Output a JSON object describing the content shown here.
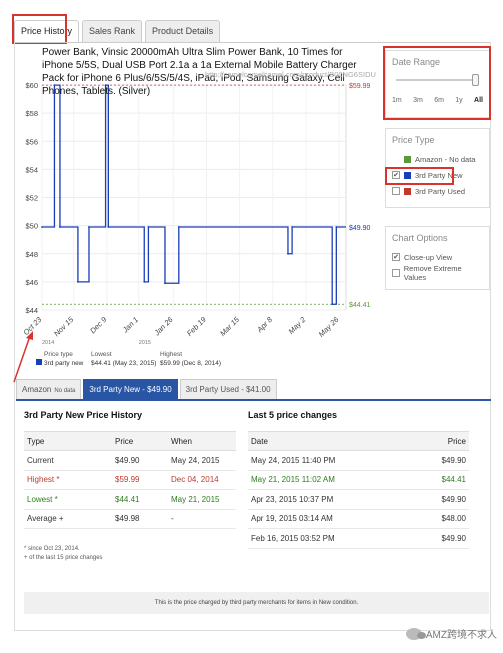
{
  "top_tabs": [
    "Price History",
    "Sales Rank",
    "Product Details"
  ],
  "product_title": "Power Bank, Vinsic 20000mAh Ultra Slim Power Bank, 10 Times for iPhone 5/5S, Dual USB Port 2.1a a 1a External Mobile Battery Charger Pack for iPhone 6 Plus/6/5S/5/4S, iPad, iPod, Samsung Galaxy, Cell Phones, Tablets. (Silver)",
  "product_url": "http://camelcamelcamel.com/product/B00NG6SIDU",
  "date_range": {
    "title": "Date Range",
    "options": [
      "1m",
      "3m",
      "6m",
      "1y",
      "All"
    ],
    "selected": "All"
  },
  "price_type": {
    "title": "Price Type",
    "items": [
      {
        "label": "Amazon - No data",
        "checked": false,
        "color": "#5a9a3a",
        "has_checkbox": false
      },
      {
        "label": "3rd Party New",
        "checked": true,
        "color": "#1a3db8",
        "has_checkbox": true
      },
      {
        "label": "3rd Party Used",
        "checked": false,
        "color": "#c0392b",
        "has_checkbox": true
      }
    ]
  },
  "chart_options": {
    "title": "Chart Options",
    "items": [
      {
        "label": "Close-up View",
        "checked": true
      },
      {
        "label": "Remove Extreme Values",
        "checked": false
      }
    ]
  },
  "chart_data": {
    "type": "line",
    "series": [
      {
        "name": "3rd Party New",
        "color": "#1a3db8",
        "points": [
          {
            "x": "2014-10-23",
            "y": 49.9
          },
          {
            "x": "2014-11-01",
            "y": 59.99
          },
          {
            "x": "2014-11-05",
            "y": 49.9
          },
          {
            "x": "2014-11-18",
            "y": 46.0
          },
          {
            "x": "2014-11-26",
            "y": 49.9
          },
          {
            "x": "2014-12-08",
            "y": 59.99
          },
          {
            "x": "2014-12-10",
            "y": 49.9
          },
          {
            "x": "2015-01-05",
            "y": 46.0
          },
          {
            "x": "2015-01-08",
            "y": 49.9
          },
          {
            "x": "2015-01-20",
            "y": 45.9
          },
          {
            "x": "2015-01-30",
            "y": 49.9
          },
          {
            "x": "2015-04-19",
            "y": 48.0
          },
          {
            "x": "2015-04-22",
            "y": 49.9
          },
          {
            "x": "2015-05-21",
            "y": 44.41
          },
          {
            "x": "2015-05-24",
            "y": 49.9
          }
        ]
      }
    ],
    "y_ticks": [
      "$44",
      "$46",
      "$48",
      "$50",
      "$52",
      "$54",
      "$56",
      "$58",
      "$60"
    ],
    "ylim": [
      44,
      60
    ],
    "x_ticks": [
      "Oct 23",
      "Nov 15",
      "Dec 9",
      "Jan 1",
      "Jan 26",
      "Feb 19",
      "Mar 15",
      "Apr 8",
      "May 2",
      "May 26"
    ],
    "x_range": [
      "2014-10-23",
      "2015-05-31"
    ],
    "year_labels": [
      {
        "label": "2014",
        "at": "2014-10-23"
      },
      {
        "label": "2015",
        "at": "2015-01-01"
      }
    ],
    "high_label": "$59.99",
    "current_label": "$49.90",
    "low_label": "$44.41",
    "high_value": 59.99,
    "current_value": 49.9,
    "low_value": 44.41,
    "legend": {
      "col1_header": "Price type",
      "col2_header": "Lowest",
      "col3_header": "Highest",
      "row_label": "3rd party new",
      "lowest": "$44.41 (May 23, 2015)",
      "highest": "$59.99 (Dec 8, 2014)"
    }
  },
  "bottom_tabs": [
    {
      "label": "Amazon",
      "suffix": "No data",
      "active": false
    },
    {
      "label": "3rd Party New - $49.90",
      "suffix": "",
      "active": true
    },
    {
      "label": "3rd Party Used - $41.00",
      "suffix": "",
      "active": false
    }
  ],
  "history_table": {
    "title": "3rd Party New Price History",
    "headers": [
      "Type",
      "Price",
      "When"
    ],
    "rows": [
      {
        "type": "Current",
        "price": "$49.90",
        "when": "May 24, 2015",
        "style": ""
      },
      {
        "type": "Highest *",
        "price": "$59.99",
        "when": "Dec 04, 2014",
        "style": "red"
      },
      {
        "type": "Lowest *",
        "price": "$44.41",
        "when": "May 21, 2015",
        "style": "green"
      },
      {
        "type": "Average +",
        "price": "$49.98",
        "when": "-",
        "style": ""
      }
    ],
    "footnote1": "* since Oct 23, 2014.",
    "footnote2": "+ of the last 15 price changes"
  },
  "changes_table": {
    "title": "Last 5 price changes",
    "headers": [
      "Date",
      "Price"
    ],
    "rows": [
      {
        "date": "May 24, 2015 11:40 PM",
        "price": "$49.90",
        "style": ""
      },
      {
        "date": "May 21, 2015 11:02 AM",
        "price": "$44.41",
        "style": "green"
      },
      {
        "date": "Apr 23, 2015 10:37 PM",
        "price": "$49.90",
        "style": ""
      },
      {
        "date": "Apr 19, 2015 03:14 AM",
        "price": "$48.00",
        "style": ""
      },
      {
        "date": "Feb 16, 2015 03:52 PM",
        "price": "$49.90",
        "style": ""
      }
    ]
  },
  "note": "This is the price charged by third party merchants for items in New condition.",
  "watermark": "AMZ跨境不求人"
}
